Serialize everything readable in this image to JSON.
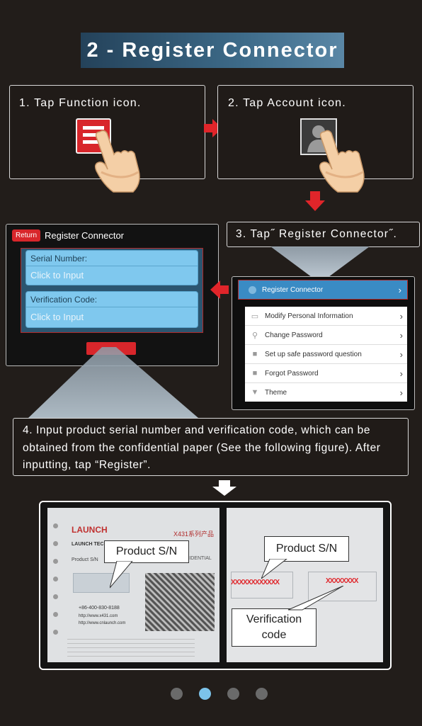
{
  "title": "2 - Register Connector",
  "step1": {
    "text": "1. Tap Function icon."
  },
  "step2": {
    "text": "2. Tap Account icon."
  },
  "step3": {
    "text": "3. Tap˝ Register Connector˝."
  },
  "step4": {
    "text": "4. Input product serial number and verification code, which can be obtained from the confidential paper (See the following figure). After inputting, tap “Register”."
  },
  "register_screen": {
    "return_label": "Return",
    "header": "Register Connector",
    "serial_label": "Serial Number:",
    "serial_placeholder": "Click to Input",
    "verify_label": "Verification Code:",
    "verify_placeholder": "Click to Input"
  },
  "account_menu": {
    "highlighted": "Register Connector",
    "items": [
      {
        "label": "Modify Personal Information",
        "icon": "monitor-icon"
      },
      {
        "label": "Change Password",
        "icon": "key-icon"
      },
      {
        "label": "Set up safe password question",
        "icon": "lock-icon"
      },
      {
        "label": "Forgot Password",
        "icon": "lock-icon"
      },
      {
        "label": "Theme",
        "icon": "shirt-icon"
      }
    ]
  },
  "paper": {
    "brand": "LAUNCH",
    "brand_sub": "LAUNCH TEC",
    "serial_row": "Product S/N",
    "phone": "+86-400-830-8188",
    "web1": "http://www.x431.com",
    "web2": "http://www.cnlaunch.com",
    "header_right": "X431系列产品",
    "confidential": "FIDENTIAL",
    "masked_serial": "XXXXXXXXXXXX",
    "masked_code": "XXXXXXXX"
  },
  "callouts": {
    "product_sn_left": "Product S/N",
    "product_sn_right": "Product S/N",
    "verification_code": "Verification code"
  },
  "pagination": {
    "count": 4,
    "active_index": 1
  },
  "colors": {
    "accent_red": "#e0252a",
    "active_dot": "#7cc3ea",
    "title_blue": "#3d6a88"
  }
}
